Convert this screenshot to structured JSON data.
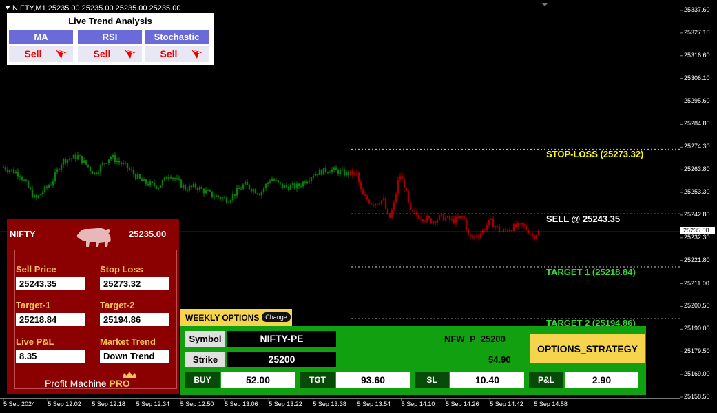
{
  "header": {
    "title": "NIFTY,M1  25235.00 25235.00 25235.00 25235.00"
  },
  "chart_data": {
    "type": "candlestick",
    "symbol": "NIFTY",
    "timeframe": "M1",
    "ylim": [
      25155,
      25340
    ],
    "x_ticks": [
      "5 Sep 2024",
      "5 Sep 12:02",
      "5 Sep 12:18",
      "5 Sep 12:34",
      "5 Sep 12:50",
      "5 Sep 13:06",
      "5 Sep 13:22",
      "5 Sep 13:38",
      "5 Sep 13:54",
      "5 Sep 14:10",
      "5 Sep 14:26",
      "5 Sep 14:42",
      "5 Sep 14:58"
    ],
    "y_ticks": [
      "25337.60",
      "25327.10",
      "25316.60",
      "25306.10",
      "25295.60",
      "25284.80",
      "25274.30",
      "25263.80",
      "25253.30",
      "25242.80",
      "25232.30",
      "25221.80",
      "25211.00",
      "25200.50",
      "25190.00",
      "25179.50",
      "25169.00",
      "25158.50"
    ],
    "current_price": "25235.00",
    "close_path": [
      {
        "x": 0.0,
        "y": 25265
      },
      {
        "x": 0.03,
        "y": 25262
      },
      {
        "x": 0.06,
        "y": 25250
      },
      {
        "x": 0.09,
        "y": 25258
      },
      {
        "x": 0.11,
        "y": 25268
      },
      {
        "x": 0.14,
        "y": 25270
      },
      {
        "x": 0.17,
        "y": 25262
      },
      {
        "x": 0.2,
        "y": 25270
      },
      {
        "x": 0.23,
        "y": 25265
      },
      {
        "x": 0.26,
        "y": 25258
      },
      {
        "x": 0.29,
        "y": 25256
      },
      {
        "x": 0.31,
        "y": 25262
      },
      {
        "x": 0.34,
        "y": 25255
      },
      {
        "x": 0.36,
        "y": 25256
      },
      {
        "x": 0.39,
        "y": 25252
      },
      {
        "x": 0.42,
        "y": 25250
      },
      {
        "x": 0.45,
        "y": 25257
      },
      {
        "x": 0.48,
        "y": 25253
      },
      {
        "x": 0.5,
        "y": 25260
      },
      {
        "x": 0.52,
        "y": 25256
      },
      {
        "x": 0.55,
        "y": 25256
      },
      {
        "x": 0.58,
        "y": 25262
      },
      {
        "x": 0.61,
        "y": 25264
      },
      {
        "x": 0.64,
        "y": 25262
      },
      {
        "x": 0.66,
        "y": 25262
      },
      {
        "x": 0.67,
        "y": 25252
      },
      {
        "x": 0.69,
        "y": 25248
      },
      {
        "x": 0.71,
        "y": 25250
      },
      {
        "x": 0.72,
        "y": 25240
      },
      {
        "x": 0.73,
        "y": 25248
      },
      {
        "x": 0.74,
        "y": 25262
      },
      {
        "x": 0.75,
        "y": 25256
      },
      {
        "x": 0.76,
        "y": 25244
      },
      {
        "x": 0.78,
        "y": 25242
      },
      {
        "x": 0.8,
        "y": 25240
      },
      {
        "x": 0.82,
        "y": 25242
      },
      {
        "x": 0.84,
        "y": 25240
      },
      {
        "x": 0.86,
        "y": 25242
      },
      {
        "x": 0.87,
        "y": 25232
      },
      {
        "x": 0.89,
        "y": 25234
      },
      {
        "x": 0.91,
        "y": 25240
      },
      {
        "x": 0.93,
        "y": 25235
      },
      {
        "x": 0.95,
        "y": 25237
      },
      {
        "x": 0.97,
        "y": 25238
      },
      {
        "x": 0.99,
        "y": 25233
      },
      {
        "x": 1.0,
        "y": 25235
      }
    ],
    "levels": {
      "stop_loss": {
        "label": "STOP-LOSS (25273.32)",
        "value": 25273.32,
        "color": "#ffff00"
      },
      "entry": {
        "label": "SELL @ 25243.35",
        "value": 25243.35,
        "color": "#ffffff"
      },
      "target1": {
        "label": "TARGET 1 (25218.84)",
        "value": 25218.84,
        "color": "#33dd33"
      },
      "target2": {
        "label": "TARGET 2 (25194.86)",
        "value": 25194.86,
        "color": "#33dd33"
      }
    },
    "colors": {
      "bull": "#0a7d0a",
      "bear": "#a00000",
      "current_line": "#9aa4b8",
      "level_line": "#ffffff"
    }
  },
  "trend": {
    "title": "Live Trend Analysis",
    "cols": [
      {
        "name": "MA",
        "signal": "Sell"
      },
      {
        "name": "RSI",
        "signal": "Sell"
      },
      {
        "name": "Stochastic",
        "signal": "Sell"
      }
    ],
    "arrow_icon": "down-arrow-icon"
  },
  "signal_panel": {
    "symbol": "NIFTY",
    "price": "25235.00",
    "mascot_icon": "bear-icon",
    "sell_price_label": "Sell Price",
    "sell_price": "25243.35",
    "stop_loss_label": "Stop Loss",
    "stop_loss": "25273.32",
    "target1_label": "Target-1",
    "target1": "25218.84",
    "target2_label": "Target-2",
    "target2": "25194.86",
    "pnl_label": "Live P&L",
    "pnl": "8.35",
    "market_trend_label": "Market Trend",
    "market_trend": "Down Trend",
    "brand": "Profit Machine",
    "brand_pro": "PRO"
  },
  "options": {
    "tab_label": "WEEKLY OPTIONS",
    "change_label": "Change",
    "symbol_label": "Symbol",
    "symbol": "NIFTY-PE",
    "strike_label": "Strike",
    "strike": "25200",
    "contract": "NFW_P_25200",
    "ltp": "54.90",
    "strategy_label": "OPTIONS_STRATEGY",
    "buy_label": "BUY",
    "buy": "52.00",
    "tgt_label": "TGT",
    "tgt": "93.60",
    "sl_label": "SL",
    "sl": "10.40",
    "pnl_label": "P&L",
    "pnl": "2.90"
  }
}
